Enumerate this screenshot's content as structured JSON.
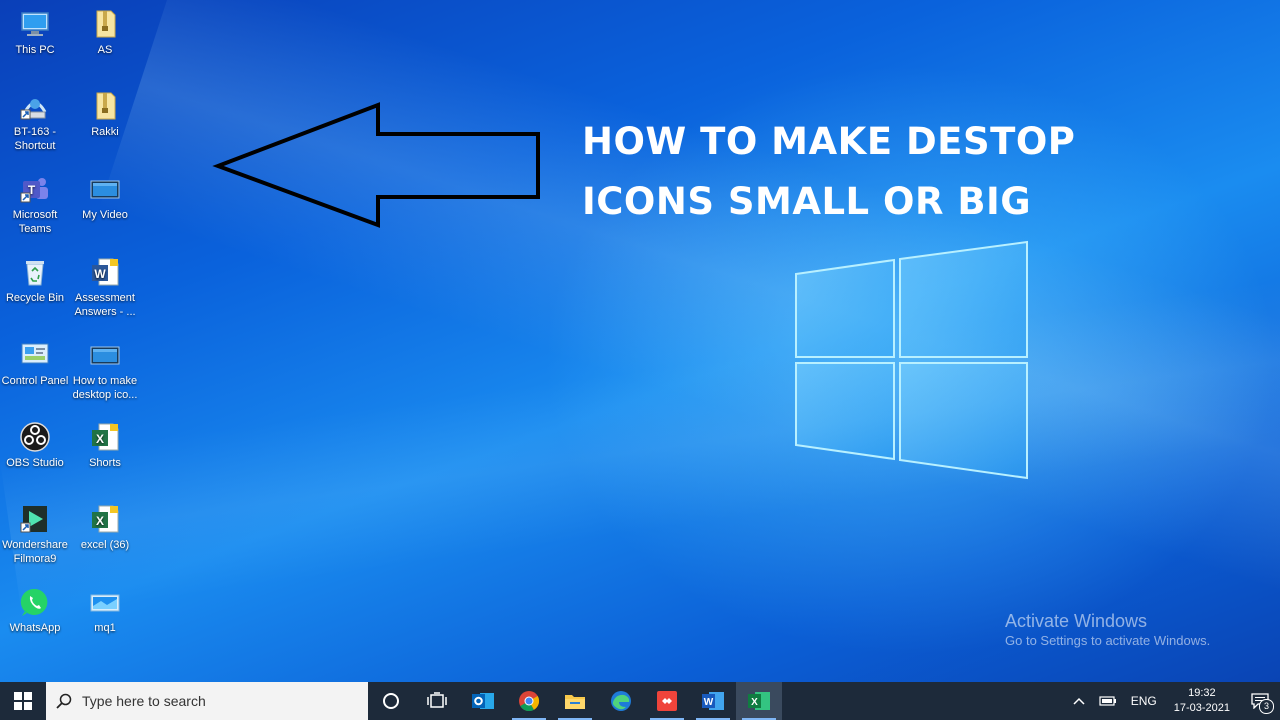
{
  "desktop": {
    "headline": [
      "HOW TO MAKE DESTOP",
      "ICONS SMALL OR BIG"
    ],
    "icons": [
      {
        "label": "This PC",
        "icon": "computer-icon"
      },
      {
        "label": "AS",
        "icon": "folder-zip-icon"
      },
      {
        "label": "BT-163 - Shortcut",
        "icon": "network-shortcut-icon"
      },
      {
        "label": "Rakki",
        "icon": "folder-zip-icon"
      },
      {
        "label": "Microsoft Teams",
        "icon": "teams-icon"
      },
      {
        "label": "My Video",
        "icon": "video-file-icon"
      },
      {
        "label": "Recycle Bin",
        "icon": "recycle-bin-icon"
      },
      {
        "label": "Assessment Answers - ...",
        "icon": "word-document-icon"
      },
      {
        "label": "Control Panel",
        "icon": "control-panel-icon"
      },
      {
        "label": "How to make desktop ico...",
        "icon": "video-file-icon"
      },
      {
        "label": "OBS Studio",
        "icon": "obs-icon"
      },
      {
        "label": "Shorts",
        "icon": "excel-document-icon"
      },
      {
        "label": "Wondershare Filmora9",
        "icon": "filmora-icon"
      },
      {
        "label": "excel (36)",
        "icon": "excel-document-icon"
      },
      {
        "label": "WhatsApp",
        "icon": "whatsapp-icon"
      },
      {
        "label": "mq1",
        "icon": "image-file-icon"
      }
    ],
    "activation": {
      "title": "Activate Windows",
      "subtitle": "Go to Settings to activate Windows."
    }
  },
  "taskbar": {
    "search_placeholder": "Type here to search",
    "apps": [
      "cortana-circle-icon",
      "task-view-icon",
      "outlook-icon",
      "chrome-icon",
      "file-explorer-icon",
      "edge-icon",
      "anydesk-icon",
      "word-icon",
      "excel-icon"
    ],
    "tray": {
      "language": "ENG",
      "time": "19:32",
      "date": "17-03-2021",
      "notification_count": "3"
    }
  },
  "colors": {
    "wallpaper_blue": "#0a5bd8",
    "taskbar": "#1d2a3a",
    "logo_glow": "#9fe4ff"
  }
}
